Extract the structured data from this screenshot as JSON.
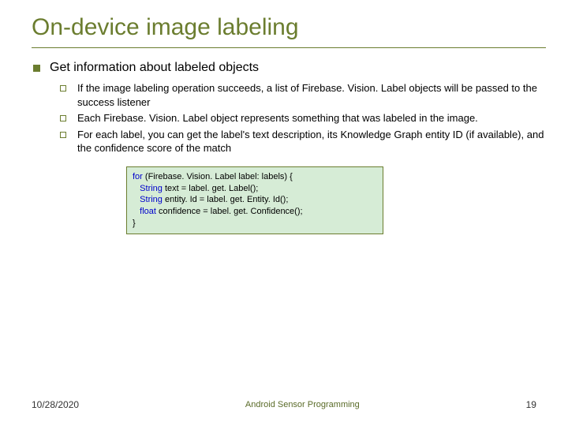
{
  "title": "On-device image labeling",
  "section": "Get information about labeled objects",
  "bullets": [
    "If the image labeling operation succeeds, a list of Firebase. Vision. Label objects will be passed to the success listener",
    "Each Firebase. Vision. Label object represents something that was labeled in the image.",
    "For each label, you can get the label's text description, its Knowledge Graph entity ID (if available), and the confidence score of the match"
  ],
  "code": {
    "kw_for": "for",
    "l1_rest": " (Firebase. Vision. Label label: labels) {",
    "kw_string1": "String",
    "l2_rest": " text = label. get. Label();",
    "kw_string2": "String",
    "l3_rest": " entity. Id = label. get. Entity. Id();",
    "kw_float": "float",
    "l4_rest": " confidence = label. get. Confidence();",
    "l5": "}"
  },
  "footer": {
    "date": "10/28/2020",
    "center": "Android Sensor Programming",
    "page": "19"
  }
}
